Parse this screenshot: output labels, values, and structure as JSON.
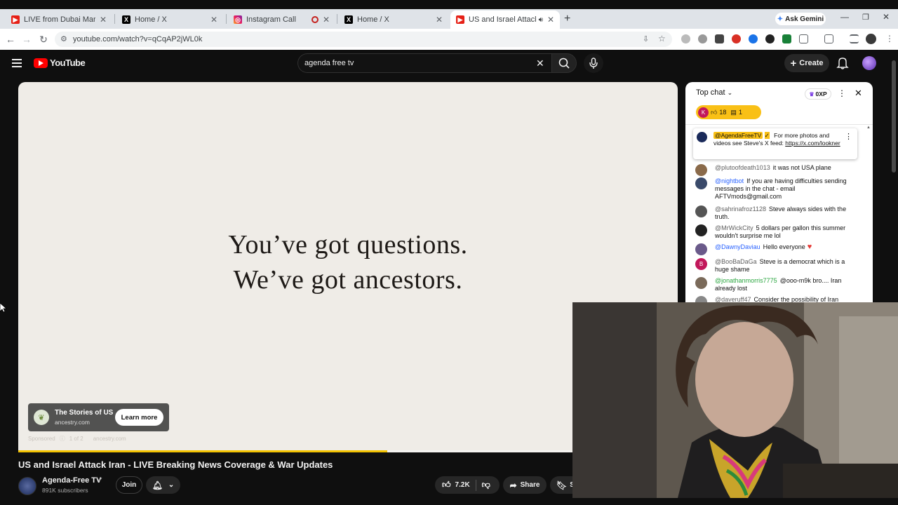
{
  "browser": {
    "tabs": [
      {
        "title": "LIVE from Dubai Marina – Tensi",
        "favicon": "youtube-favicon",
        "active": false
      },
      {
        "title": "Home / X",
        "favicon": "x-favicon",
        "active": false
      },
      {
        "title": "Instagram Call",
        "favicon": "instagram-favicon",
        "active": false
      },
      {
        "title": "Home / X",
        "favicon": "x-favicon",
        "active": false
      },
      {
        "title": "US and Israel Attack Iran - L",
        "favicon": "youtube-favicon",
        "active": true
      }
    ],
    "ask_gemini": "Ask Gemini",
    "url": "youtube.com/watch?v=qCqAP2jWL0k"
  },
  "youtube": {
    "logo_text": "YouTube",
    "search_value": "agenda free tv",
    "create_label": "Create"
  },
  "player": {
    "ad_line1": "You’ve got questions.",
    "ad_line2": "We’ve got ancestors.",
    "ad_card": {
      "title": "The Stories of US",
      "domain": "ancestry.com",
      "cta": "Learn more"
    },
    "sponsored": {
      "label": "Sponsored",
      "count": "1 of 2",
      "domain": "ancestry.com"
    },
    "progress": 0.56,
    "progress_color": "#f2c200"
  },
  "chat": {
    "header": "Top chat",
    "xp": "0XP",
    "poll": {
      "avatar_letter": "K",
      "likes": "18",
      "comments": "1"
    },
    "pinned": {
      "author": "@AgendaFreeTV",
      "text": "For more photos and videos see Steve's X feed:",
      "link": "https://x.com/lookner"
    },
    "messages": [
      {
        "author": "@plutoofdeath1013",
        "text": "it was not USA plane",
        "avatar_color": "#8a6a4a"
      },
      {
        "author": "@nightbot",
        "text": "If you are having difficulties sending messages in the chat - email AFTVmods@gmail.com",
        "avatar_color": "#3a4a6a",
        "author_color": "#2962ff"
      },
      {
        "author": "@sahrinafroz1128",
        "text": "Steve always sides with the truth.",
        "avatar_color": "#555555"
      },
      {
        "author": "@MrWickCity",
        "text": "5 dollars per gallon this summer wouldn't surprise me lol",
        "avatar_color": "#222222"
      },
      {
        "author": "@DawnyDaviau",
        "text": "Hello everyone",
        "avatar_color": "#6a5a8a",
        "author_color": "#2962ff"
      },
      {
        "author": "@BooBaDaGa",
        "text": "Steve is a democrat which is a huge shame",
        "avatar_color": "#c2185b",
        "avatar_letter": "B"
      },
      {
        "author": "@jonathanmorris7775",
        "text": "@ooo-m9k bro.... Iran already lost",
        "avatar_color": "#7a6a5a",
        "author_color": "#2ba640"
      },
      {
        "author": "@daveruff47",
        "text": "Consider the possibility of Iran",
        "avatar_color": "#888888"
      }
    ]
  },
  "video": {
    "title": "US and Israel Attack Iran - LIVE Breaking News Coverage & War Updates",
    "channel": "Agenda-Free TV",
    "subscribers": "891K subscribers",
    "join_label": "Join",
    "likes": "7.2K",
    "share_label": "Share",
    "save_label": "S"
  }
}
